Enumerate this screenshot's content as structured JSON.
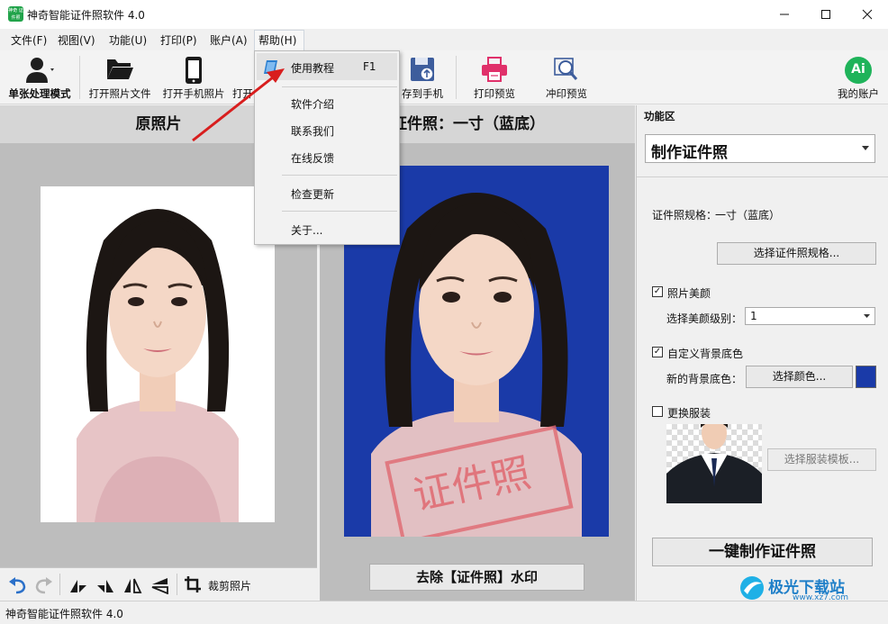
{
  "window": {
    "title": "神奇智能证件照软件 4.0",
    "app_icon_text": "神奇 证件照"
  },
  "menu": {
    "items": [
      "文件(F)",
      "视图(V)",
      "功能(U)",
      "打印(P)",
      "账户(A)",
      "帮助(H)"
    ]
  },
  "toolbar": {
    "single_mode": "单张处理模式",
    "open_file": "打开照片文件",
    "open_phone": "打开手机照片",
    "open_partial": "打开",
    "save_phone": "存到手机",
    "print_preview": "打印预览",
    "photo_print_preview": "冲印预览",
    "account": "我的账户",
    "account_badge": "Ai"
  },
  "help_menu": {
    "tutorial": "使用教程",
    "tutorial_shortcut": "F1",
    "intro": "软件介绍",
    "contact": "联系我们",
    "feedback": "在线反馈",
    "update": "检查更新",
    "about": "关于..."
  },
  "left_pane": {
    "title": "原照片",
    "crop": "裁剪照片"
  },
  "mid_pane": {
    "title_visible": "证件照：一寸（蓝底）",
    "stamp": "证件照",
    "remove_watermark": "去除【证件照】水印"
  },
  "right_pane": {
    "title": "功能区",
    "mode_select": "制作证件照",
    "spec_label": "证件照规格：",
    "spec_value": "一寸（蓝底）",
    "choose_spec": "选择证件照规格...",
    "beauty_label": "照片美颜",
    "beauty_checked": true,
    "beauty_level_label": "选择美颜级别：",
    "beauty_level_value": "1",
    "custom_bg_label": "自定义背景底色",
    "custom_bg_checked": true,
    "new_bg_label": "新的背景底色：",
    "choose_color": "选择颜色...",
    "bg_color": "#1a3aa8",
    "change_clothes_label": "更换服装",
    "change_clothes_checked": false,
    "choose_clothes": "选择服装模板...",
    "make_button": "一键制作证件照"
  },
  "status": {
    "text": "神奇智能证件照软件 4.0"
  },
  "watermark": {
    "text": "极光下载站",
    "url": "www.xz7.com"
  }
}
